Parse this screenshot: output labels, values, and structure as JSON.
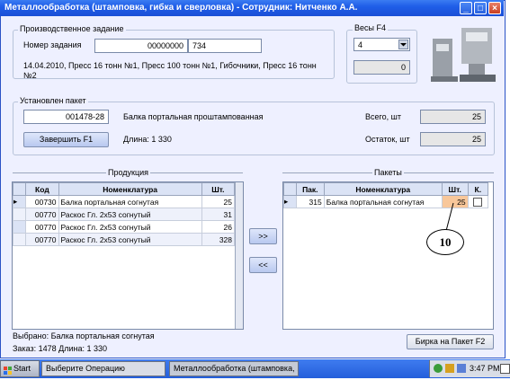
{
  "window": {
    "title": "Металлообработка (штамповка, гибка и сверловка) - Сотрудник: Нитченко А.А."
  },
  "task": {
    "group_label": "Производственное задание",
    "number_label": "Номер задания",
    "number_value": "00000000",
    "number_suffix": "734",
    "description": "14.04.2010, Пресс 16 тонн №1, Пресс 100 тонн №1, Гибочники, Пресс 16 тонн №2"
  },
  "scale": {
    "group_label": "Весы  F4",
    "selected": "4",
    "reading": "0"
  },
  "package": {
    "group_label": "Установлен пакет",
    "code": "001478-28",
    "name": "Балка портальная проштампованная",
    "length_text": "Длина: 1 330",
    "finish_button": "Завершить      F1",
    "total_label": "Всего, шт",
    "total_value": "25",
    "remaining_label": "Остаток, шт",
    "remaining_value": "25"
  },
  "products": {
    "title": "Продукция",
    "columns": [
      "Код",
      "Номенклатура",
      "Шт."
    ],
    "rows": [
      {
        "code": "00730",
        "name": "Балка портальная согнутая",
        "qty": "25"
      },
      {
        "code": "00770",
        "name": "Раскос Гл. 2х53 согнутый",
        "qty": "31"
      },
      {
        "code": "00770",
        "name": "Раскос Гл. 2х53 согнутый",
        "qty": "26"
      },
      {
        "code": "00770",
        "name": "Раскос Гл. 2х53 согнутый",
        "qty": "328"
      }
    ]
  },
  "move": {
    "forward": ">>",
    "back": "<<"
  },
  "packages": {
    "title": "Пакеты",
    "columns": [
      "Пак.",
      "Номенклатура",
      "Шт.",
      "К."
    ],
    "rows": [
      {
        "pack": "315",
        "name": "Балка портальная согнутая",
        "qty": "25"
      }
    ]
  },
  "annotation": {
    "label": "10"
  },
  "footer": {
    "selected_text": "Выбрано: Балка портальная согнутая",
    "order_text": "Заказ: 1478  Длина: 1 330",
    "tag_button": "Бирка на Пакет   F2"
  },
  "taskbar": {
    "start": "Start",
    "items": [
      "Выберите Операцию",
      "Металлообработка (штамповка, ..."
    ],
    "clock": "3:47 PM"
  }
}
